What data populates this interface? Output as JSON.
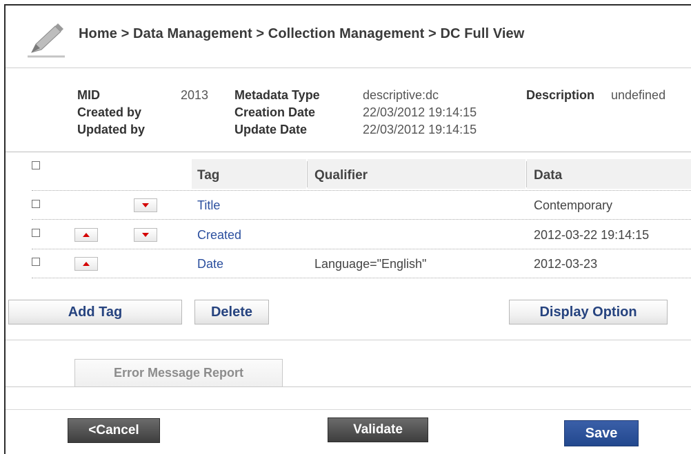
{
  "breadcrumb": "Home > Data Management > Collection Management > DC Full View",
  "meta": {
    "mid_label": "MID",
    "mid_value": "2013",
    "created_by_label": "Created by",
    "updated_by_label": "Updated by",
    "metadata_type_label": "Metadata Type",
    "metadata_type_value": "descriptive:dc",
    "creation_date_label": "Creation Date",
    "creation_date_value": "22/03/2012 19:14:15",
    "update_date_label": "Update Date",
    "update_date_value": "22/03/2012 19:14:15",
    "description_label": "Description",
    "description_value": "undefined"
  },
  "table": {
    "headers": {
      "tag": "Tag",
      "qualifier": "Qualifier",
      "data": "Data"
    },
    "rows": [
      {
        "tag": "Title",
        "qualifier": "",
        "data": "Contemporary",
        "up": false,
        "down": true
      },
      {
        "tag": "Created",
        "qualifier": "",
        "data": "2012-03-22 19:14:15",
        "up": true,
        "down": true
      },
      {
        "tag": "Date",
        "qualifier": "Language=\"English\"",
        "data": "2012-03-23",
        "up": true,
        "down": false
      }
    ]
  },
  "actions": {
    "add_tag": "Add Tag",
    "delete": "Delete",
    "display_option": "Display Option"
  },
  "tab": {
    "error_report": "Error Message Report"
  },
  "footer": {
    "cancel": "<Cancel",
    "validate": "Validate",
    "save": "Save"
  },
  "colors": {
    "link": "#2b4f9e",
    "arrow": "#d40000",
    "save_button": "#2a4f98",
    "dark_button": "#4a4a4a"
  },
  "icons": {
    "header": "pencil-icon",
    "move_up": "arrow-up-icon",
    "move_down": "arrow-down-icon"
  }
}
